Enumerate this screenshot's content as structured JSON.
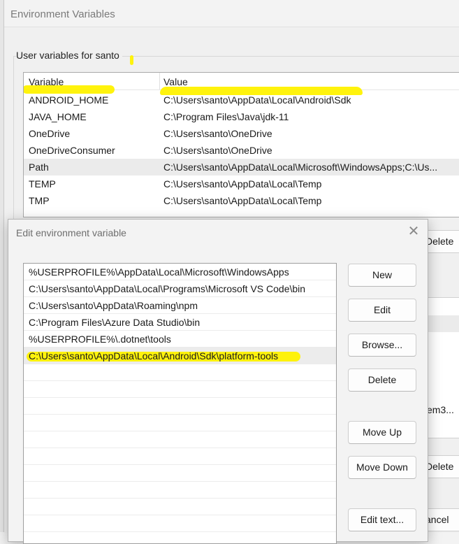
{
  "env_window": {
    "title": "Environment Variables",
    "user_group_label": "User variables for santo",
    "columns": {
      "variable": "Variable",
      "value": "Value"
    },
    "user_vars": [
      {
        "name": "ANDROID_HOME",
        "value": "C:\\Users\\santo\\AppData\\Local\\Android\\Sdk"
      },
      {
        "name": "JAVA_HOME",
        "value": "C:\\Program Files\\Java\\jdk-11"
      },
      {
        "name": "OneDrive",
        "value": "C:\\Users\\santo\\OneDrive"
      },
      {
        "name": "OneDriveConsumer",
        "value": "C:\\Users\\santo\\OneDrive"
      },
      {
        "name": "Path",
        "value": "C:\\Users\\santo\\AppData\\Local\\Microsoft\\WindowsApps;C:\\Us..."
      },
      {
        "name": "TEMP",
        "value": "C:\\Users\\santo\\AppData\\Local\\Temp"
      },
      {
        "name": "TMP",
        "value": "C:\\Users\\santo\\AppData\\Local\\Temp"
      }
    ],
    "user_delete_partial": "Delete",
    "system_value_partial": "em3...",
    "system_delete_partial": "Delete",
    "cancel_partial": "ancel"
  },
  "edit_dialog": {
    "title": "Edit environment variable",
    "close_glyph": "✕",
    "paths": [
      "%USERPROFILE%\\AppData\\Local\\Microsoft\\WindowsApps",
      "C:\\Users\\santo\\AppData\\Local\\Programs\\Microsoft VS Code\\bin",
      "C:\\Users\\santo\\AppData\\Roaming\\npm",
      "C:\\Program Files\\Azure Data Studio\\bin",
      "%USERPROFILE%\\.dotnet\\tools",
      "C:\\Users\\santo\\AppData\\Local\\Android\\Sdk\\platform-tools"
    ],
    "buttons": {
      "new": "New",
      "edit": "Edit",
      "browse": "Browse...",
      "delete": "Delete",
      "move_up": "Move Up",
      "move_down": "Move Down",
      "edit_text": "Edit text..."
    }
  },
  "colors": {
    "highlighter": "#fff200",
    "selection": "#ebebeb"
  }
}
